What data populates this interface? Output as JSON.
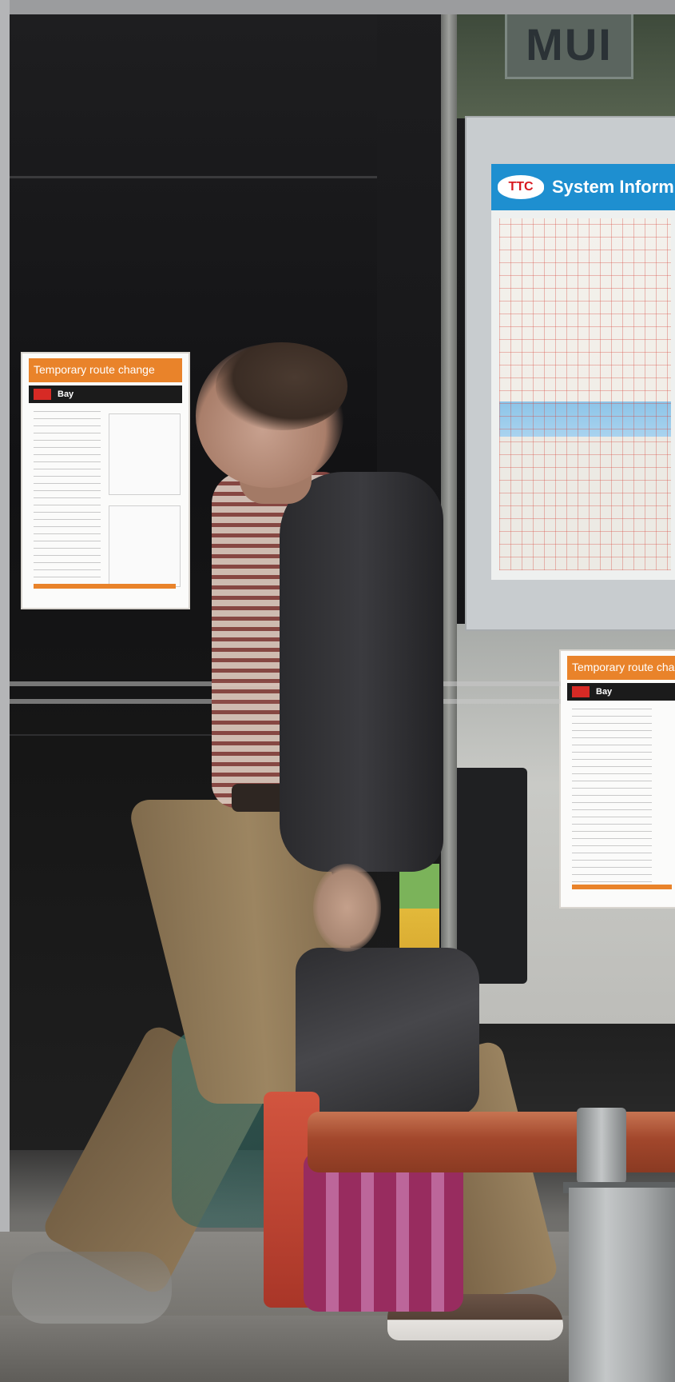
{
  "scene": {
    "store_sign": "MUI",
    "map_poster": {
      "logo": "TTC",
      "title": "System Inform"
    },
    "notice_left": {
      "header": "Temporary route change",
      "route": "Bay"
    },
    "notice_right": {
      "header": "Temporary route change",
      "route": "Bay"
    },
    "icons": [
      "no-smoking-icon",
      "ttc-logo-icon"
    ]
  }
}
